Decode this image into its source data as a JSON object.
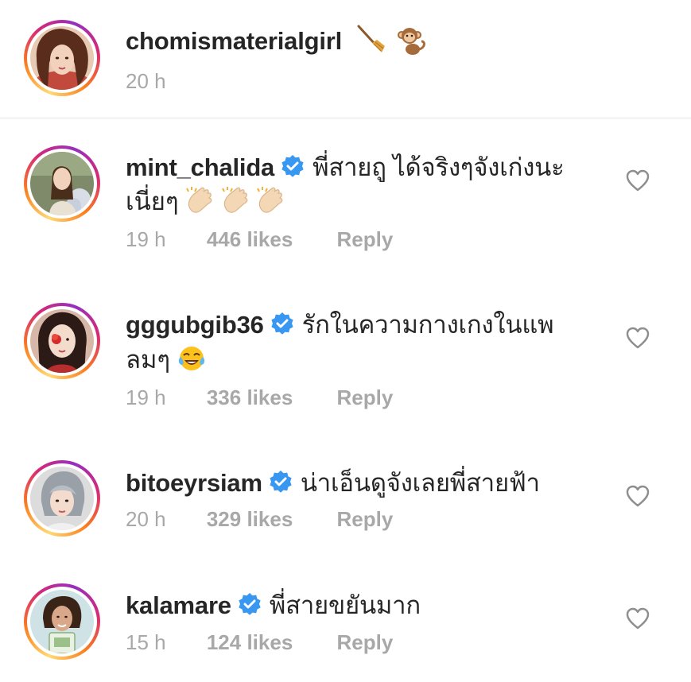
{
  "post": {
    "username": "chomismaterialgirl",
    "emojis": [
      "broom-icon",
      "monkey-icon"
    ],
    "time": "20 h"
  },
  "comments": [
    {
      "username": "mint_chalida",
      "verified": true,
      "text_line1": "พี่สายฤู ได้จริงๆจังเก่งนะ",
      "text_line2": "เนี่ยๆ",
      "emojis": [
        "clapping-hands-icon",
        "clapping-hands-icon",
        "clapping-hands-icon"
      ],
      "time": "19 h",
      "likes": "446 likes",
      "reply": "Reply"
    },
    {
      "username": "gggubgib36",
      "verified": true,
      "text_line1": "รักในความกางเกงในแพ",
      "text_line2": "ลมๆ",
      "emojis": [
        "laughing-tears-icon"
      ],
      "time": "19 h",
      "likes": "336 likes",
      "reply": "Reply"
    },
    {
      "username": "bitoeyrsiam",
      "verified": true,
      "text_line1": "น่าเอ็นดูจังเลยพี่สายฟ้า",
      "time": "20 h",
      "likes": "329 likes",
      "reply": "Reply"
    },
    {
      "username": "kalamare",
      "verified": true,
      "text_line1": "พี่สายขยันมาก",
      "time": "15 h",
      "likes": "124 likes",
      "reply": "Reply"
    }
  ],
  "colors": {
    "verified_badge": "#3897f0",
    "meta_text": "#a8a8a8",
    "primary_text": "#262626"
  }
}
